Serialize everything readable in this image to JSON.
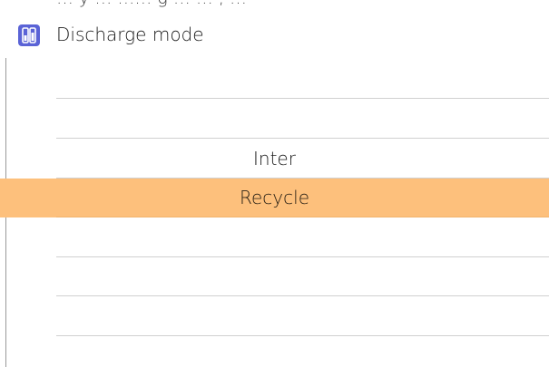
{
  "header": {
    "partial_text_above": "… y … …… g … … , …",
    "title": "Discharge mode",
    "icon": "battery-mode-icon",
    "icon_color": "#5a63d6"
  },
  "picker": {
    "options": [
      "",
      "",
      "Inter",
      "Recycle",
      "",
      "",
      ""
    ],
    "selected_option": "Recycle",
    "selected_color": "#fdc07c"
  }
}
